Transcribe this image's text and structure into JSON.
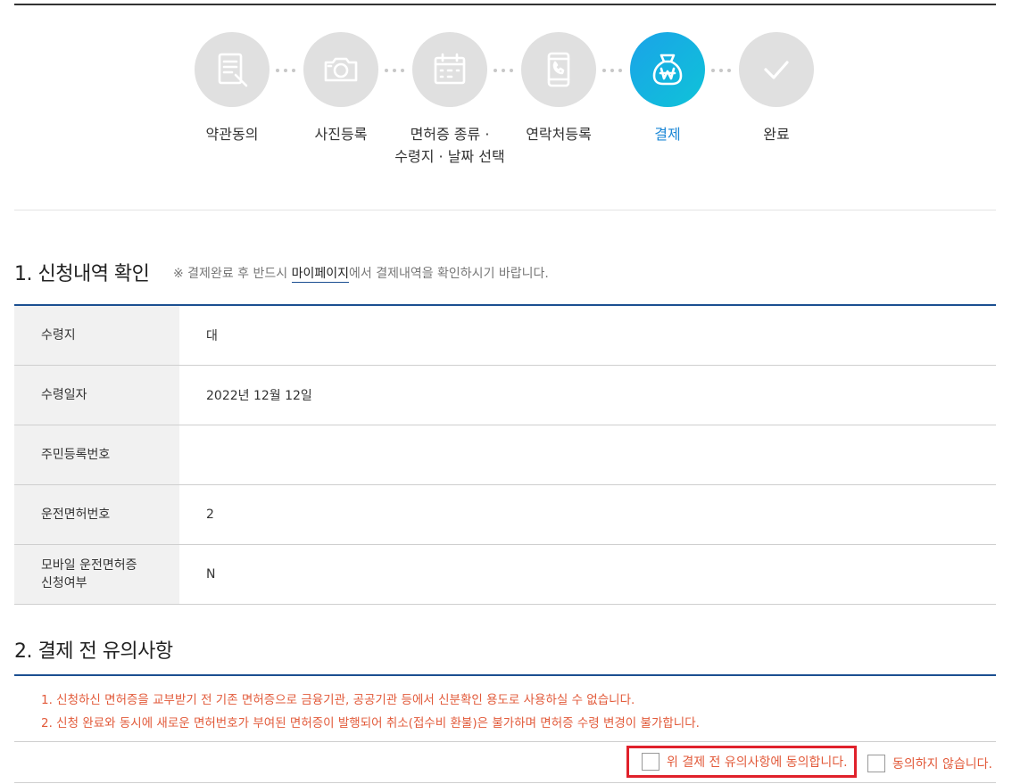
{
  "steps": [
    {
      "label": "약관동의",
      "icon": "document-pen-icon",
      "active": false
    },
    {
      "label": "사진등록",
      "icon": "camera-icon",
      "active": false
    },
    {
      "label_line1": "면허증 종류 ·",
      "label_line2": "수령지 · 날짜 선택",
      "icon": "calendar-icon",
      "active": false
    },
    {
      "label": "연락처등록",
      "icon": "phone-icon",
      "active": false
    },
    {
      "label": "결제",
      "icon": "won-pouch-icon",
      "active": true
    },
    {
      "label": "완료",
      "icon": "check-icon",
      "active": false
    }
  ],
  "section1": {
    "title": "1. 신청내역 확인",
    "note_prefix": "※ 결제완료 후 반드시 ",
    "note_link": "마이페이지",
    "note_suffix": "에서 결제내역을 확인하시기 바랍니다.",
    "rows": [
      {
        "label": "수령지",
        "value": "대"
      },
      {
        "label": "수령일자",
        "value": "2022년 12월 12일"
      },
      {
        "label": "주민등록번호",
        "value": ""
      },
      {
        "label": "운전면허번호",
        "value": "2"
      },
      {
        "label_line1": "모바일 운전면허증",
        "label_line2": "신청여부",
        "value": "N"
      }
    ]
  },
  "section2": {
    "title": "2. 결제 전 유의사항",
    "notices": [
      "1. 신청하신 면허증을 교부받기 전 기존 면허증으로 금융기관, 공공기관 등에서 신분확인 용도로 사용하실 수 없습니다.",
      "2. 신청 완료와 동시에 새로운 면허번호가 부여된 면허증이 발행되어 취소(접수비 환불)은 불가하며 면허증 수령 변경이 불가합니다."
    ],
    "agree_label": "위 결제 전 유의사항에 동의합니다.",
    "disagree_label": "동의하지 않습니다."
  },
  "colors": {
    "active_step": "#1aa3e8",
    "notice_text": "#e25a3a",
    "highlight_border": "#e0212b",
    "section_line": "#1b4f91"
  }
}
